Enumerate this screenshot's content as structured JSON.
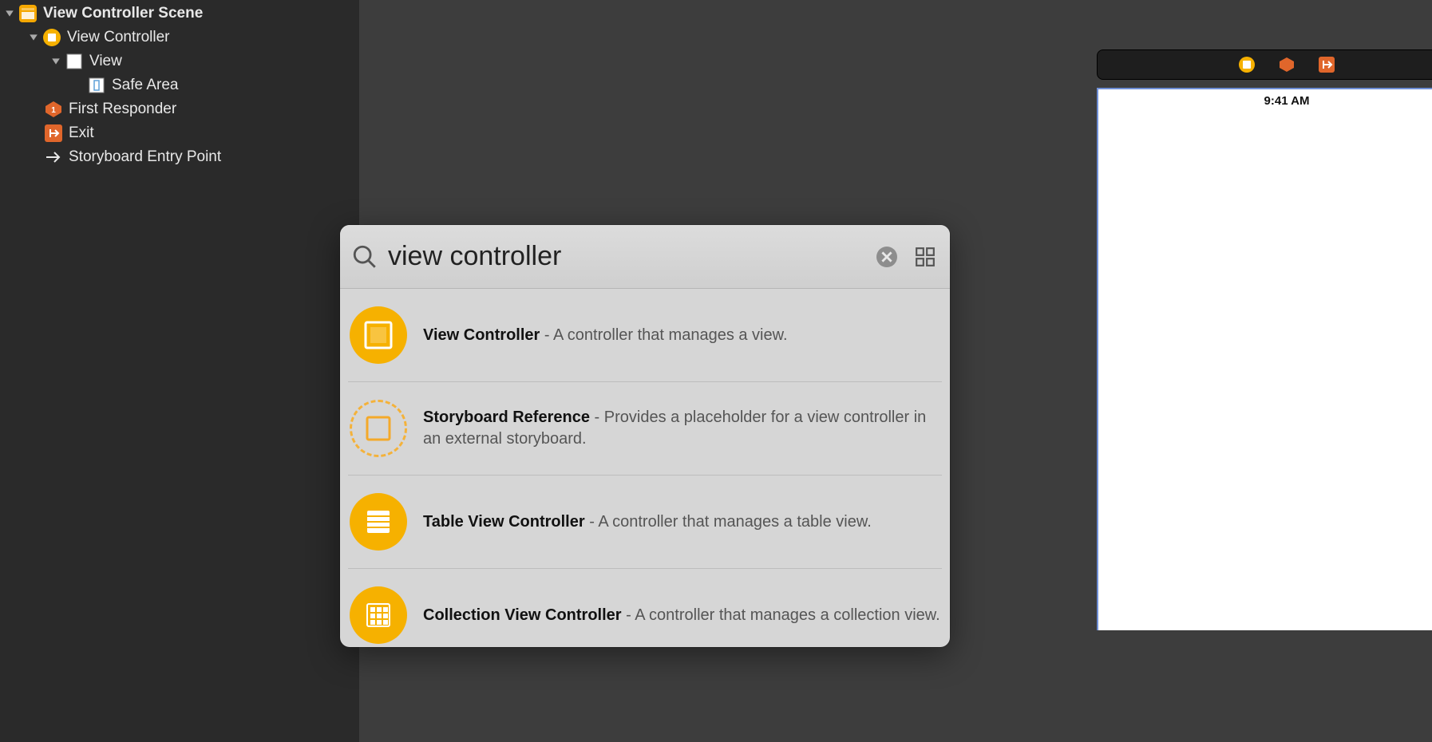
{
  "outline": {
    "scene": "View Controller Scene",
    "vc": "View Controller",
    "view": "View",
    "safeArea": "Safe Area",
    "firstResponder": "First Responder",
    "exit": "Exit",
    "entryPoint": "Storyboard Entry Point"
  },
  "device": {
    "time": "9:41 AM"
  },
  "library": {
    "search": "view controller",
    "items": [
      {
        "title": "View Controller",
        "desc": "A controller that manages a view."
      },
      {
        "title": "Storyboard Reference",
        "desc": "Provides a placeholder for a view controller in an external storyboard."
      },
      {
        "title": "Table View Controller",
        "desc": "A controller that manages a table view."
      },
      {
        "title": "Collection View Controller",
        "desc": "A controller that manages a collection view."
      }
    ]
  }
}
